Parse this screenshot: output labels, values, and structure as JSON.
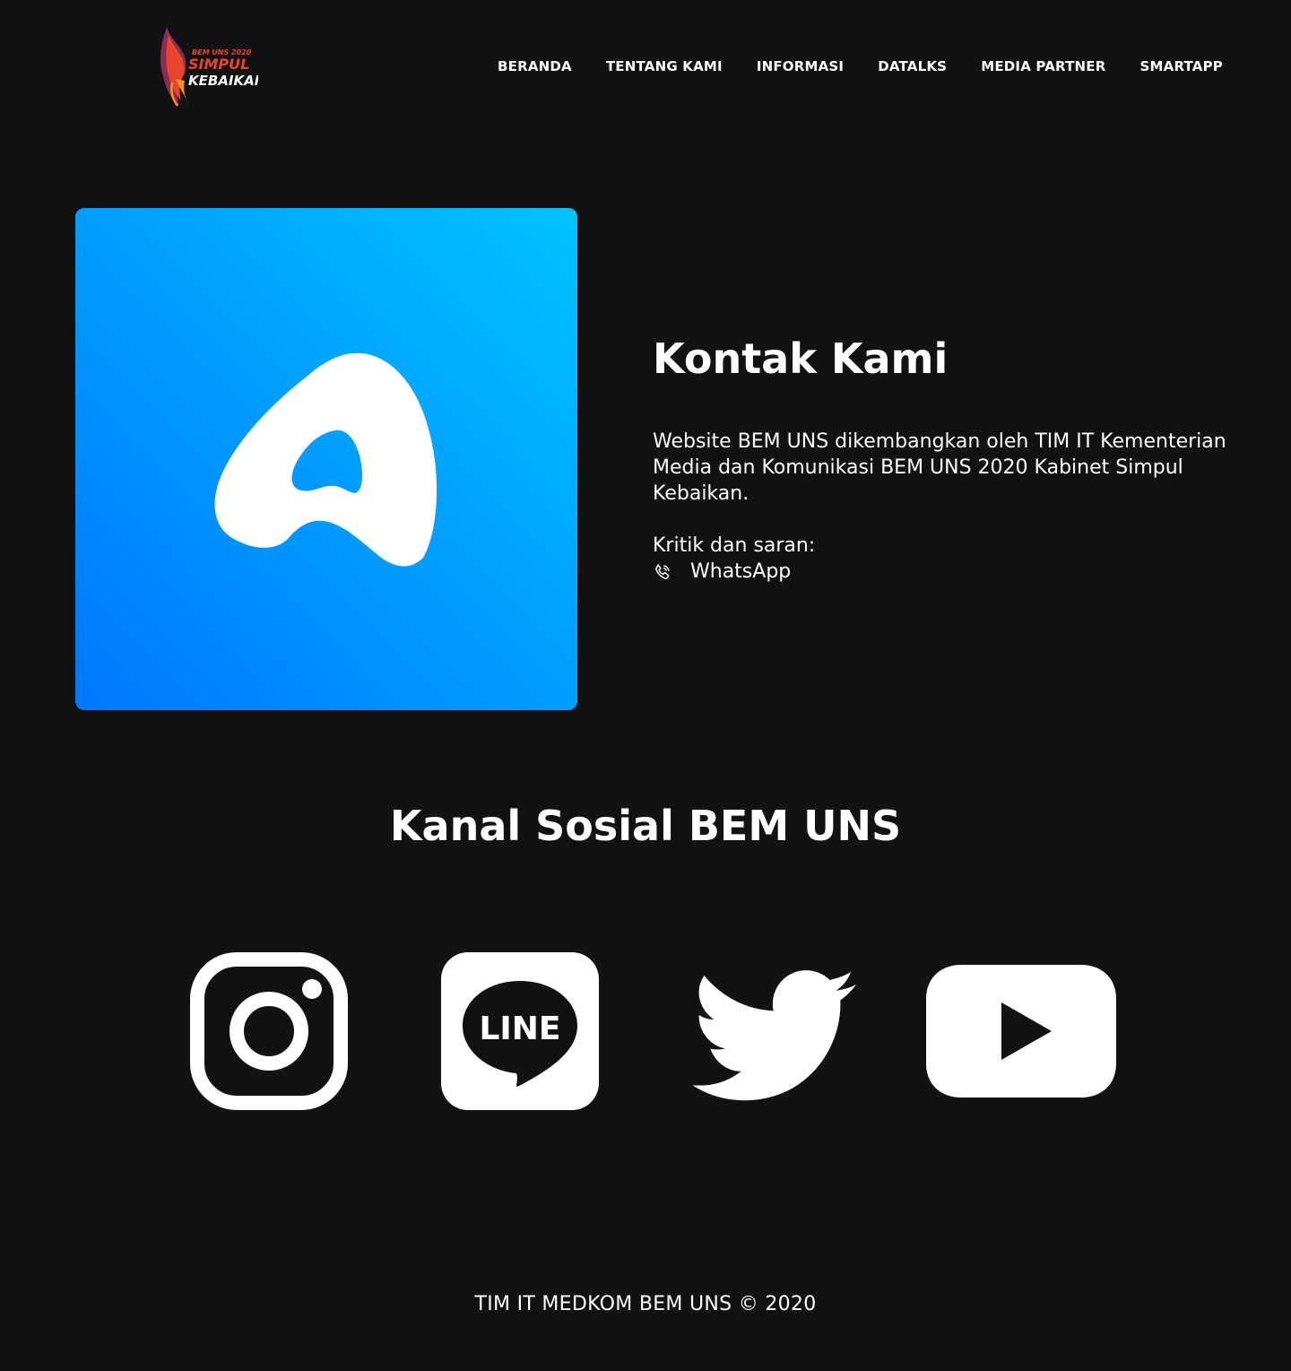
{
  "header": {
    "logo_small_text": "BEM UNS 2020",
    "logo_line1": "SIMPUL",
    "logo_line2": "KEBAIKAN",
    "nav": [
      {
        "label": "BERANDA"
      },
      {
        "label": "TENTANG KAMI"
      },
      {
        "label": "INFORMASI"
      },
      {
        "label": "DATALKS"
      },
      {
        "label": "MEDIA PARTNER"
      },
      {
        "label": "SMARTAPP"
      }
    ]
  },
  "hero": {
    "app_icon": "app-logo-a-icon",
    "gradient_start": "#00c3ff",
    "gradient_end": "#0077ff"
  },
  "contact": {
    "title": "Kontak Kami",
    "description": "Website BEM UNS dikembangkan oleh TIM IT Kementerian Media dan Komunikasi BEM UNS 2020 Kabinet Simpul Kebaikan.",
    "kritik_label": "Kritik dan saran:",
    "whatsapp_label": "WhatsApp",
    "whatsapp_icon": "phone-icon"
  },
  "social": {
    "title": "Kanal Sosial BEM UNS",
    "icons": [
      "instagram-icon",
      "line-icon",
      "twitter-icon",
      "youtube-icon"
    ],
    "line_text": "LINE"
  },
  "footer": {
    "text": "TIM IT MEDKOM BEM UNS © 2020"
  },
  "colors": {
    "background": "#121212",
    "foreground": "#ffffff",
    "logo_red": "#e8452c",
    "logo_orange": "#f7931e",
    "logo_purple": "#8b2a5c"
  }
}
